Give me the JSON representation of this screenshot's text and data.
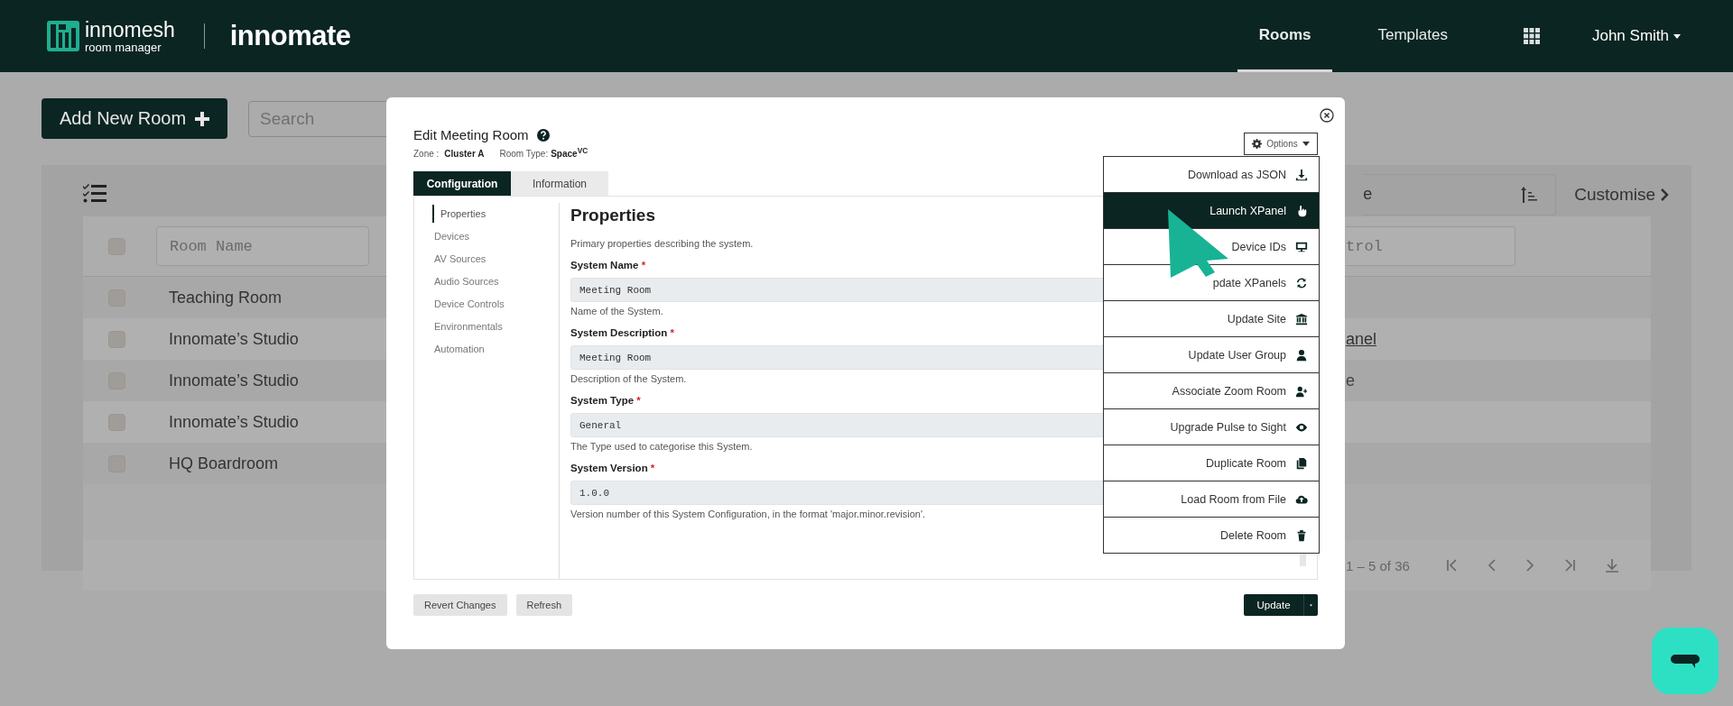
{
  "header": {
    "brand": "innomesh",
    "tagline": "room manager",
    "product": "innomate",
    "nav": [
      {
        "label": "Rooms",
        "selected": true
      },
      {
        "label": "Templates",
        "selected": false
      }
    ],
    "user": "John Smith"
  },
  "page": {
    "add_button": "Add New Room",
    "search": {
      "placeholder": "Search"
    },
    "sort_field": {
      "value": "e"
    },
    "customise": "Customise",
    "select_all": {
      "checked": false
    },
    "filters": [
      {
        "placeholder": "Room Name"
      },
      {
        "placeholder": "trol"
      }
    ],
    "rows": [
      {
        "name": "Teaching Room",
        "checked": false
      },
      {
        "name": "Innomate’s Studio",
        "checked": false,
        "column_3": {
          "text": "anel",
          "kind": "link"
        }
      },
      {
        "name": "Innomate’s Studio",
        "checked": false,
        "column_3": {
          "text": "e",
          "kind": "text"
        }
      },
      {
        "name": "Innomate’s Studio",
        "checked": false
      },
      {
        "name": "HQ Boardroom",
        "checked": false
      }
    ],
    "pagination": "1 – 5 of 36"
  },
  "modal": {
    "title": "Edit Meeting Room",
    "zone_label": "Zone :",
    "zone": "Cluster A",
    "room_type_label": "Room Type:",
    "room_type": "Space$^{VC}$",
    "options_button": "Options",
    "menu": [
      {
        "label": "Download as JSON",
        "selected": false
      },
      {
        "label": "Launch XPanel",
        "selected": true
      },
      {
        "label": "Device IDs",
        "selected": false
      },
      {
        "label": "pdate XPanels",
        "selected": false
      },
      {
        "label": "Update Site",
        "selected": false
      },
      {
        "label": "Update User Group",
        "selected": false
      },
      {
        "label": "Associate Zoom Room",
        "selected": false
      },
      {
        "label": "Upgrade Pulse to Sight",
        "selected": false
      },
      {
        "label": "Duplicate Room",
        "selected": false
      },
      {
        "label": "Load Room from File",
        "selected": false
      },
      {
        "label": "Delete Room",
        "selected": false
      }
    ],
    "tabs": [
      {
        "label": "Configuration",
        "selected": true
      },
      {
        "label": "Information",
        "selected": false
      }
    ],
    "nav": [
      {
        "label": "Properties",
        "selected": true
      },
      {
        "label": "Devices",
        "selected": false
      },
      {
        "label": "AV Sources",
        "selected": false
      },
      {
        "label": "Audio Sources",
        "selected": false
      },
      {
        "label": "Device Controls",
        "selected": false
      },
      {
        "label": "Environmentals",
        "selected": false
      },
      {
        "label": "Automation",
        "selected": false
      }
    ],
    "section_title": "Properties",
    "section_description": "Primary properties describing the system.",
    "fields": [
      {
        "label": "System Name",
        "marker": "*",
        "value": "Meeting Room",
        "help": "Name of the System."
      },
      {
        "label": "System Description",
        "marker": "*",
        "value": "Meeting Room",
        "help": "Description of the System."
      },
      {
        "label": "System Type",
        "marker": "*",
        "value": "General",
        "help": "The Type used to categorise this System."
      },
      {
        "label": "System Version",
        "marker": "*",
        "value": "1.0.0",
        "help": "Version number of this System Configuration, in the format 'major.minor.revision'."
      }
    ],
    "buttons": {
      "revert": "Revert Changes",
      "refresh": "Refresh",
      "update": "Update"
    }
  }
}
